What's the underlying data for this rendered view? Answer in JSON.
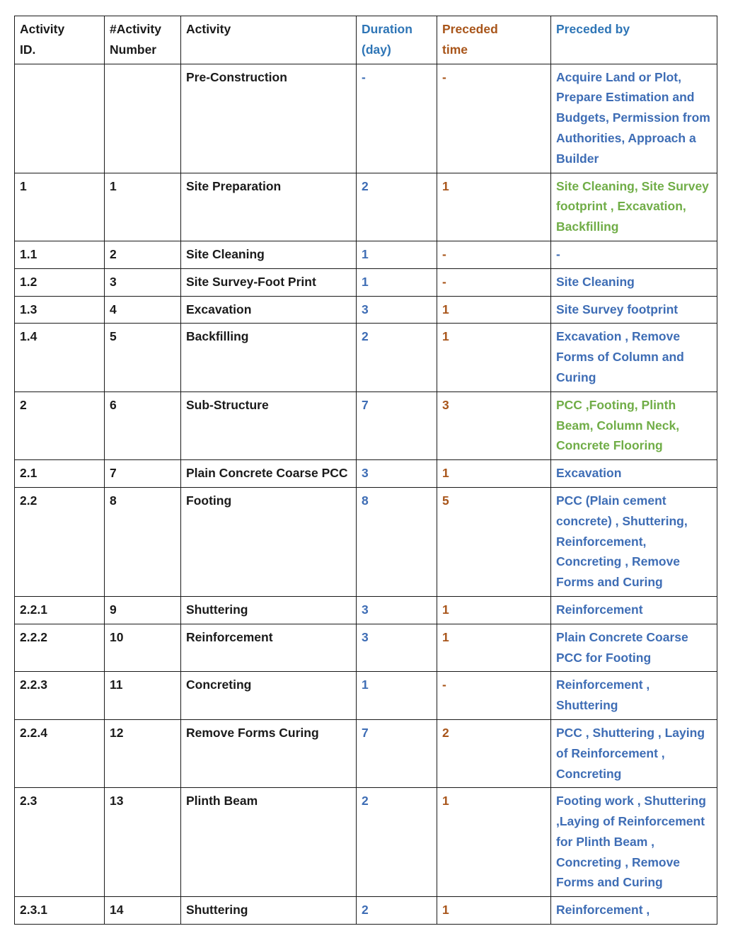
{
  "table": {
    "columns": [
      {
        "key": "activity_id",
        "label": "Activity ID.",
        "color_role": "black"
      },
      {
        "key": "activity_num",
        "label": "#Activity Number",
        "color_role": "black"
      },
      {
        "key": "activity",
        "label": "Activity",
        "color_role": "black"
      },
      {
        "key": "duration",
        "label": "Duration (day)",
        "color_role": "blue"
      },
      {
        "key": "preceded_time",
        "label": "Preceded time",
        "color_role": "orange"
      },
      {
        "key": "preceded_by",
        "label": "Preceded by",
        "color_role": "blue"
      }
    ],
    "header": {
      "activity_id_line1": "Activity",
      "activity_id_line2": "ID.",
      "activity_num_line1": "#Activity",
      "activity_num_line2": "Number",
      "activity": "Activity",
      "duration_line1": "Duration",
      "duration_line2": "(day)",
      "preceded_time_line1": "Preceded",
      "preceded_time_line2": "time",
      "preceded_by": "Preceded by"
    },
    "rows": [
      {
        "activity_id": "",
        "activity_num": "",
        "activity": "Pre-Construction",
        "duration": "-",
        "preceded_time": "-",
        "preceded_by": "Acquire Land or Plot, Prepare Estimation and Budgets, Permission from Authorities, Approach a Builder",
        "summary": false
      },
      {
        "activity_id": "1",
        "activity_num": "1",
        "activity": "Site Preparation",
        "duration": "2",
        "preceded_time": "1",
        "preceded_by": "Site Cleaning, Site Survey footprint , Excavation, Backfilling",
        "summary": true
      },
      {
        "activity_id": "1.1",
        "activity_num": "2",
        "activity": "Site Cleaning",
        "duration": "1",
        "preceded_time": "-",
        "preceded_by": "-",
        "summary": false
      },
      {
        "activity_id": "1.2",
        "activity_num": "3",
        "activity": "Site Survey-Foot Print",
        "duration": "1",
        "preceded_time": "-",
        "preceded_by": "Site Cleaning",
        "summary": false
      },
      {
        "activity_id": "1.3",
        "activity_num": "4",
        "activity": "Excavation",
        "duration": "3",
        "preceded_time": "1",
        "preceded_by": "Site Survey footprint",
        "summary": false
      },
      {
        "activity_id": "1.4",
        "activity_num": "5",
        "activity": "Backfilling",
        "duration": "2",
        "preceded_time": "1",
        "preceded_by": "Excavation , Remove Forms of Column and Curing",
        "summary": false
      },
      {
        "activity_id": "2",
        "activity_num": "6",
        "activity": "Sub-Structure",
        "duration": "7",
        "preceded_time": "3",
        "preceded_by": "PCC ,Footing, Plinth Beam, Column Neck, Concrete Flooring",
        "summary": true
      },
      {
        "activity_id": "2.1",
        "activity_num": "7",
        "activity": "Plain Concrete Coarse PCC",
        "duration": "3",
        "preceded_time": "1",
        "preceded_by": "Excavation",
        "summary": false
      },
      {
        "activity_id": "2.2",
        "activity_num": "8",
        "activity": "Footing",
        "duration": "8",
        "preceded_time": "5",
        "preceded_by": "PCC (Plain cement concrete) , Shuttering, Reinforcement, Concreting , Remove Forms and Curing",
        "summary": false
      },
      {
        "activity_id": "2.2.1",
        "activity_num": "9",
        "activity": "Shuttering",
        "duration": "3",
        "preceded_time": "1",
        "preceded_by": "Reinforcement",
        "summary": false
      },
      {
        "activity_id": "2.2.2",
        "activity_num": "10",
        "activity": "Reinforcement",
        "duration": "3",
        "preceded_time": "1",
        "preceded_by": "Plain Concrete Coarse PCC for Footing",
        "summary": false
      },
      {
        "activity_id": "2.2.3",
        "activity_num": "11",
        "activity": "Concreting",
        "duration": "1",
        "preceded_time": "-",
        "preceded_by": "Reinforcement , Shuttering",
        "summary": false
      },
      {
        "activity_id": "2.2.4",
        "activity_num": "12",
        "activity": "Remove Forms Curing",
        "duration": "7",
        "preceded_time": "2",
        "preceded_by": "PCC , Shuttering , Laying of Reinforcement , Concreting",
        "summary": false
      },
      {
        "activity_id": "2.3",
        "activity_num": "13",
        "activity": "Plinth Beam",
        "duration": "2",
        "preceded_time": "1",
        "preceded_by": "Footing work , Shuttering ,Laying of Reinforcement for Plinth Beam , Concreting , Remove Forms and Curing",
        "summary": false
      },
      {
        "activity_id": "2.3.1",
        "activity_num": "14",
        "activity": "Shuttering",
        "duration": "2",
        "preceded_time": "1",
        "preceded_by": "Reinforcement ,",
        "summary": false
      }
    ]
  },
  "colors": {
    "text_black": "#1a1a1a",
    "header_blue": "#2e75b6",
    "body_blue": "#3e6db5",
    "orange": "#a8551a",
    "green": "#70ad47",
    "border": "#1a1a1a",
    "background": "#ffffff"
  }
}
